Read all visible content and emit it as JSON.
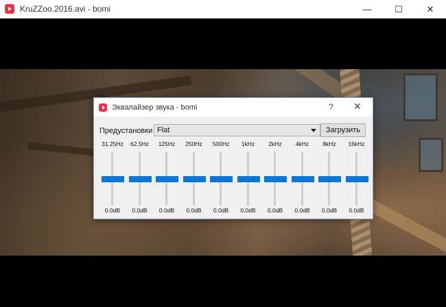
{
  "window": {
    "title": "KruZZoo.2016.avi - bomi",
    "minimize": "—",
    "maximize": "☐",
    "close": "✕"
  },
  "dialog": {
    "title": "Эквалайзер звука - bomi",
    "help": "?",
    "close": "✕",
    "preset_label": "Предустановки",
    "preset_value": "Flat",
    "load_label": "Загрузить",
    "accent_color": "#0a76d6",
    "bands": [
      {
        "freq": "31.25Hz",
        "gain": "0.0dB",
        "level": 0.5
      },
      {
        "freq": "62.5Hz",
        "gain": "0.0dB",
        "level": 0.5
      },
      {
        "freq": "125Hz",
        "gain": "0.0dB",
        "level": 0.5
      },
      {
        "freq": "250Hz",
        "gain": "0.0dB",
        "level": 0.5
      },
      {
        "freq": "500Hz",
        "gain": "0.0dB",
        "level": 0.5
      },
      {
        "freq": "1kHz",
        "gain": "0.0dB",
        "level": 0.5
      },
      {
        "freq": "2kHz",
        "gain": "0.0dB",
        "level": 0.5
      },
      {
        "freq": "4kHz",
        "gain": "0.0dB",
        "level": 0.5
      },
      {
        "freq": "8kHz",
        "gain": "0.0dB",
        "level": 0.5
      },
      {
        "freq": "16kHz",
        "gain": "0.0dB",
        "level": 0.5
      }
    ]
  }
}
